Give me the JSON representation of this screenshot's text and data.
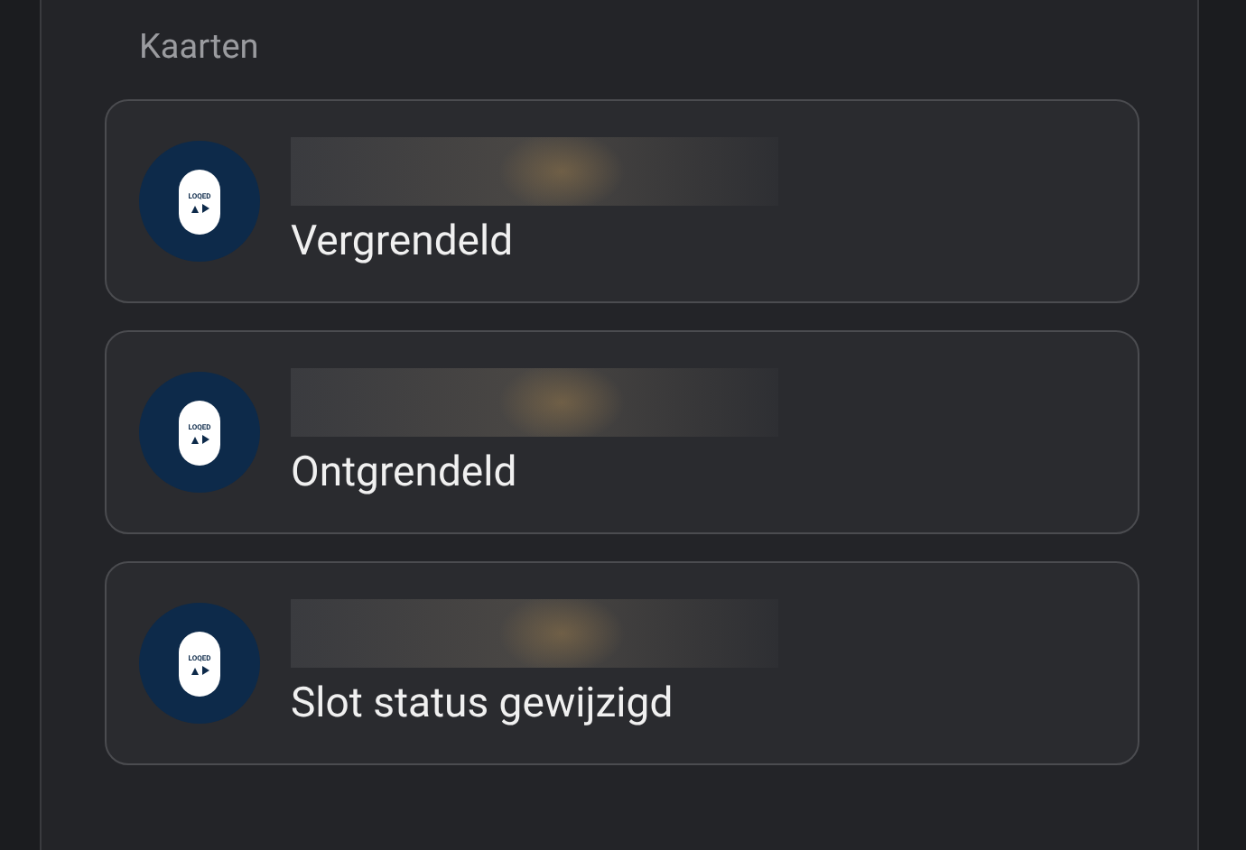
{
  "section": {
    "title": "Kaarten"
  },
  "cards": [
    {
      "logo_text": "LOQED",
      "message": "Vergrendeld"
    },
    {
      "logo_text": "LOQED",
      "message": "Ontgrendeld"
    },
    {
      "logo_text": "LOQED",
      "message": "Slot status gewijzigd"
    }
  ]
}
